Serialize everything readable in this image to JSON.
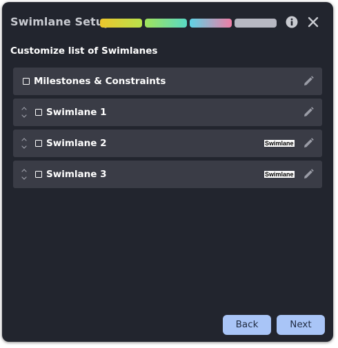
{
  "dialog": {
    "title": "Swimlane Setup",
    "subtitle": "Customize list of Swimlanes",
    "step_colors": [
      [
        "#ecc52c",
        "#b9e34c"
      ],
      [
        "#a0e35c",
        "#59d9c4"
      ],
      [
        "#5fd2e4",
        "#ef7ea6"
      ],
      [
        "#b7b8c2",
        "#b7b8c2"
      ]
    ],
    "info_icon": "info-circle-icon",
    "close_icon": "close-icon"
  },
  "rows": [
    {
      "label": "Milestones & Constraints",
      "draggable": false,
      "checked": false,
      "badge": ""
    },
    {
      "label": "Swimlane 1",
      "draggable": true,
      "checked": false,
      "badge": ""
    },
    {
      "label": "Swimlane 2",
      "draggable": true,
      "checked": false,
      "badge": "Swimlane"
    },
    {
      "label": "Swimlane 3",
      "draggable": true,
      "checked": false,
      "badge": "Swimlane"
    }
  ],
  "footer": {
    "back_label": "Back",
    "next_label": "Next"
  },
  "colors": {
    "background": "#22252e",
    "row": "#3a3c46",
    "button": "#a9c5f7"
  }
}
